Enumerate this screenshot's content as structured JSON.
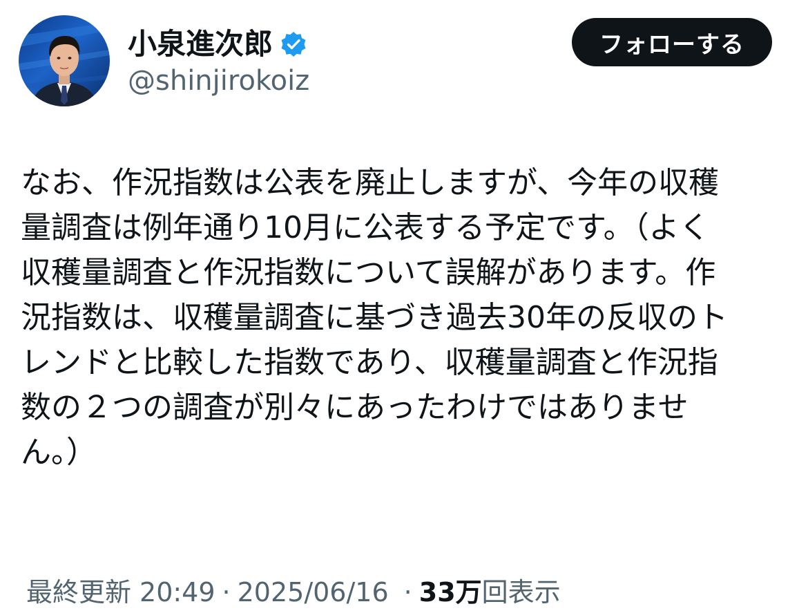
{
  "author": {
    "display_name": "小泉進次郎",
    "handle": "@shinjirokoiz",
    "verified_icon": "verified-badge-icon",
    "verified_color": "#1d9bf0"
  },
  "actions": {
    "follow_label": "フォローする"
  },
  "tweet": {
    "text_lines": [
      "なお、作況指数は公表を廃止しますが、今年の収穫",
      "量調査は例年通り10月に公表する予定です。（よく",
      "収穫量調査と作況指数について誤解があります。作",
      "況指数は、収穫量調査に基づき過去30年の反収のト",
      "レンドと比較した指数であり、収穫量調査と作況指",
      "数の２つの調査が別々にあったわけではありませ",
      "ん。）"
    ]
  },
  "meta": {
    "edited_label": "最終更新",
    "time": "20:49",
    "separator": "·",
    "date": "2025/06/16",
    "views_count": "33万",
    "views_label": "回表示"
  },
  "colors": {
    "text": "#0f1419",
    "secondary": "#536471",
    "button_bg": "#0f1419",
    "button_text": "#ffffff"
  }
}
